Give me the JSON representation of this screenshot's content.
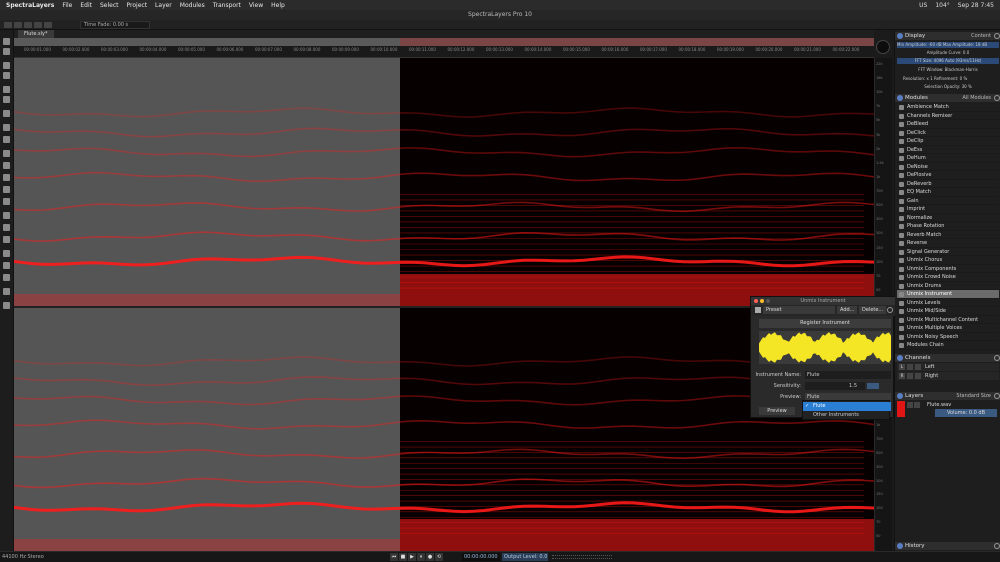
{
  "menubar": {
    "app_name": "SpectraLayers",
    "items": [
      "File",
      "Edit",
      "Select",
      "Project",
      "Layer",
      "Modules",
      "Transport",
      "View",
      "Help"
    ],
    "status_right": [
      "US",
      "104°",
      "Sep 28  7:45"
    ]
  },
  "window": {
    "title": "SpectraLayers Pro 10"
  },
  "toolbar": {
    "status_text": "Time Fade: 0.00 s"
  },
  "tabs": [
    {
      "label": "Flute.sly*"
    }
  ],
  "ruler": {
    "ticks": [
      "00:00:01.000",
      "00:00:02.000",
      "00:00:03.000",
      "00:00:04.000",
      "00:00:05.000",
      "00:00:06.000",
      "00:00:07.000",
      "00:00:08.000",
      "00:00:09.000",
      "00:00:10.000",
      "00:00:11.000",
      "00:00:12.000",
      "00:00:13.000",
      "00:00:14.000",
      "00:00:15.000",
      "00:00:16.000",
      "00:00:17.000",
      "00:00:18.000",
      "00:00:19.000",
      "00:00:20.000",
      "00:00:21.000",
      "00:00:22.000"
    ]
  },
  "freq_axis": {
    "labels": [
      "22k",
      "16k",
      "10k",
      "7k",
      "5k",
      "3k",
      "2k",
      "1.5k",
      "1k",
      "700",
      "500",
      "300",
      "200",
      "150",
      "100",
      "70",
      "50"
    ]
  },
  "display_panel": {
    "title": "Display",
    "mode": "Content",
    "rows": [
      "Min Amplitude: -60 dB   Max Amplitude: 18 dB",
      "Amplitude Curve: 0.0",
      "FFT Size: 4096 Auto (93ms/11Hz)",
      "FFT Window: Blackman-Harris",
      "Resolution: x 1         Refinement: 0 %",
      "Selection Opacity: 30 %"
    ]
  },
  "modules_panel": {
    "title": "Modules",
    "filter": "All Modules",
    "items": [
      "Ambience Match",
      "Channels Remixer",
      "DeBleed",
      "DeClick",
      "DeClip",
      "DeEss",
      "DeHum",
      "DeNoise",
      "DePlosive",
      "DeReverb",
      "EQ Match",
      "Gain",
      "Imprint",
      "Normalize",
      "Phase Rotation",
      "Reverb Match",
      "Reverse",
      "Signal Generator",
      "Unmix Chorus",
      "Unmix Components",
      "Unmix Crowd Noise",
      "Unmix Drums",
      "Unmix Instrument",
      "Unmix Levels",
      "Unmix Mid/Side",
      "Unmix Multichannel Content",
      "Unmix Multiple Voices",
      "Unmix Noisy Speech",
      "Modules Chain"
    ],
    "selected_index": 22
  },
  "channels_panel": {
    "title": "Channels",
    "items": [
      {
        "letter": "L",
        "name": "Left"
      },
      {
        "letter": "R",
        "name": "Right"
      }
    ]
  },
  "layers_panel": {
    "title": "Layers",
    "view": "Standard Size",
    "layer_name": "Flute.wav",
    "volume": "Volume: 0.0 dB"
  },
  "history_panel": {
    "title": "History"
  },
  "dialog": {
    "title": "Unmix Instrument",
    "preset_label": "Preset",
    "add_label": "Add...",
    "delete_label": "Delete...",
    "register_label": "Register Instrument",
    "instrument_name_label": "Instrument Name:",
    "instrument_name_value": "Flute",
    "sensitivity_label": "Sensitivity:",
    "sensitivity_value": "1.5",
    "preview_label": "Preview:",
    "preview_value": "Flute",
    "preview_button": "Preview",
    "options": [
      "Flute",
      "Other Instruments"
    ],
    "selected_option": "Flute"
  },
  "statusbar": {
    "left_text": "44100 Hz Stereo",
    "timecode": "00:00:00.000",
    "output_level": "Output Level: 0.0 dB",
    "transport_buttons": [
      "⏮",
      "■",
      "▶",
      "⏸",
      "●",
      "⟲"
    ]
  },
  "colors": {
    "accent": "#2a7fd4",
    "spectrum": "#ff1a1a",
    "selection_tint": "#7a4545"
  }
}
